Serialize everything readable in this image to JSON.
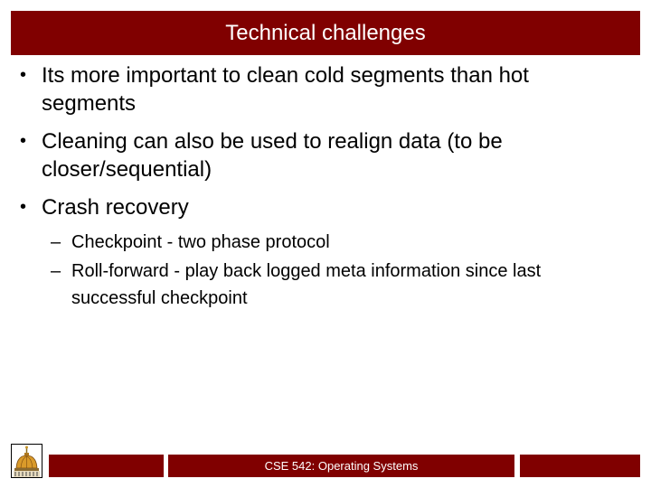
{
  "slide": {
    "title": "Technical challenges",
    "bullets": [
      {
        "marker": "•",
        "lines": [
          "Its more important to clean cold segments than hot",
          "segments"
        ]
      },
      {
        "marker": "•",
        "lines": [
          "Cleaning can also be used to realign data (to be",
          "closer/sequential)"
        ]
      },
      {
        "marker": "•",
        "lines": [
          "Crash recovery"
        ]
      }
    ],
    "sub_bullets": [
      {
        "marker": "–",
        "lines": [
          "Checkpoint - two phase protocol"
        ]
      },
      {
        "marker": "–",
        "lines": [
          "Roll-forward - play back logged meta information since last",
          "successful checkpoint"
        ]
      }
    ]
  },
  "footer": {
    "logo_icon": "golden-dome-logo",
    "center_text": "CSE 542: Operating Systems",
    "left_text": "",
    "right_text": ""
  },
  "colors": {
    "accent": "#800000",
    "title_text": "#ffffff",
    "body_text": "#000000"
  }
}
